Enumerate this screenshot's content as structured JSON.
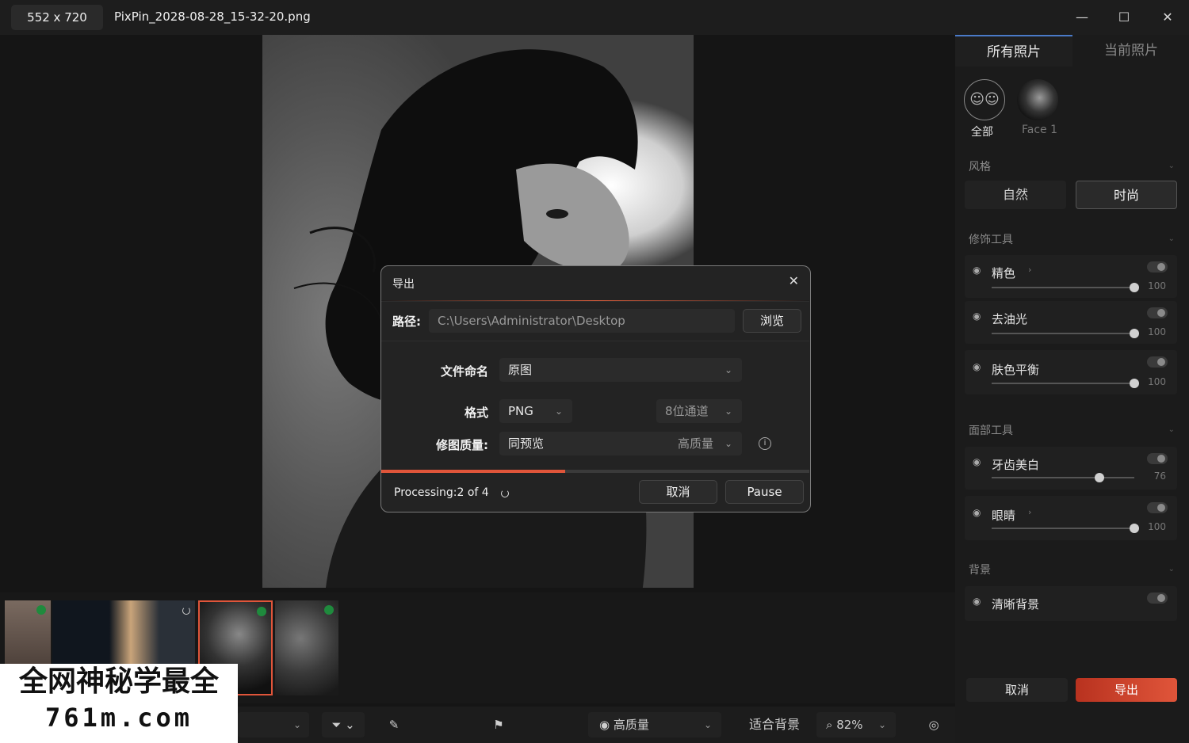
{
  "titlebar": {
    "dimensions": "552 x 720",
    "filename": "PixPin_2028-08-28_15-32-20.png",
    "minimize": "—",
    "maximize": "☐",
    "close": "✕"
  },
  "right_panel": {
    "tabs": [
      "所有照片",
      "当前照片"
    ],
    "faces": [
      {
        "label": "全部"
      },
      {
        "label": "Face 1"
      }
    ],
    "style_section": {
      "title": "风格",
      "options": [
        "自然",
        "时尚"
      ],
      "selected": "时尚"
    },
    "tool_section_1": {
      "title": "修饰工具",
      "tools": [
        {
          "name": "精色",
          "value": "100",
          "level": 1.0,
          "has_arrow": true
        },
        {
          "name": "去油光",
          "value": "100",
          "level": 1.0,
          "has_arrow": false
        },
        {
          "name": "肤色平衡",
          "value": "100",
          "level": 1.0,
          "has_arrow": false
        }
      ]
    },
    "tool_section_2": {
      "title": "面部工具",
      "tools": [
        {
          "name": "牙齿美白",
          "value": "76",
          "level": 0.76,
          "has_arrow": false
        },
        {
          "name": "眼睛",
          "value": "100",
          "level": 1.0,
          "has_arrow": true
        }
      ]
    },
    "tool_section_3": {
      "title": "背景",
      "tools": [
        {
          "name": "清晰背景"
        }
      ]
    },
    "cancel_label": "取消",
    "export_label": "导出"
  },
  "toolbar": {
    "quality_label": "高质量",
    "fit_label": "适合背景",
    "zoom": "82%"
  },
  "dialog": {
    "title": "导出",
    "path_label": "路径:",
    "path_value": "C:\\Users\\Administrator\\Desktop",
    "browse_label": "浏览",
    "naming_label": "文件命名",
    "naming_value": "原图",
    "format_label": "格式",
    "format_value": "PNG",
    "channel_value": "8位通道",
    "quality_label": "修图质量:",
    "quality_value": "同预览",
    "quality_level": "高质量",
    "status_text": "Processing:2 of 4",
    "progress": 0.43,
    "cancel_label": "取消",
    "pause_label": "Pause"
  },
  "watermark": {
    "line1": "全网神秘学最全",
    "line2": "761m.com"
  },
  "colors": {
    "accent": "#e0553a",
    "export_button": "#c8402a",
    "badge_green": "#1f8a3d"
  }
}
